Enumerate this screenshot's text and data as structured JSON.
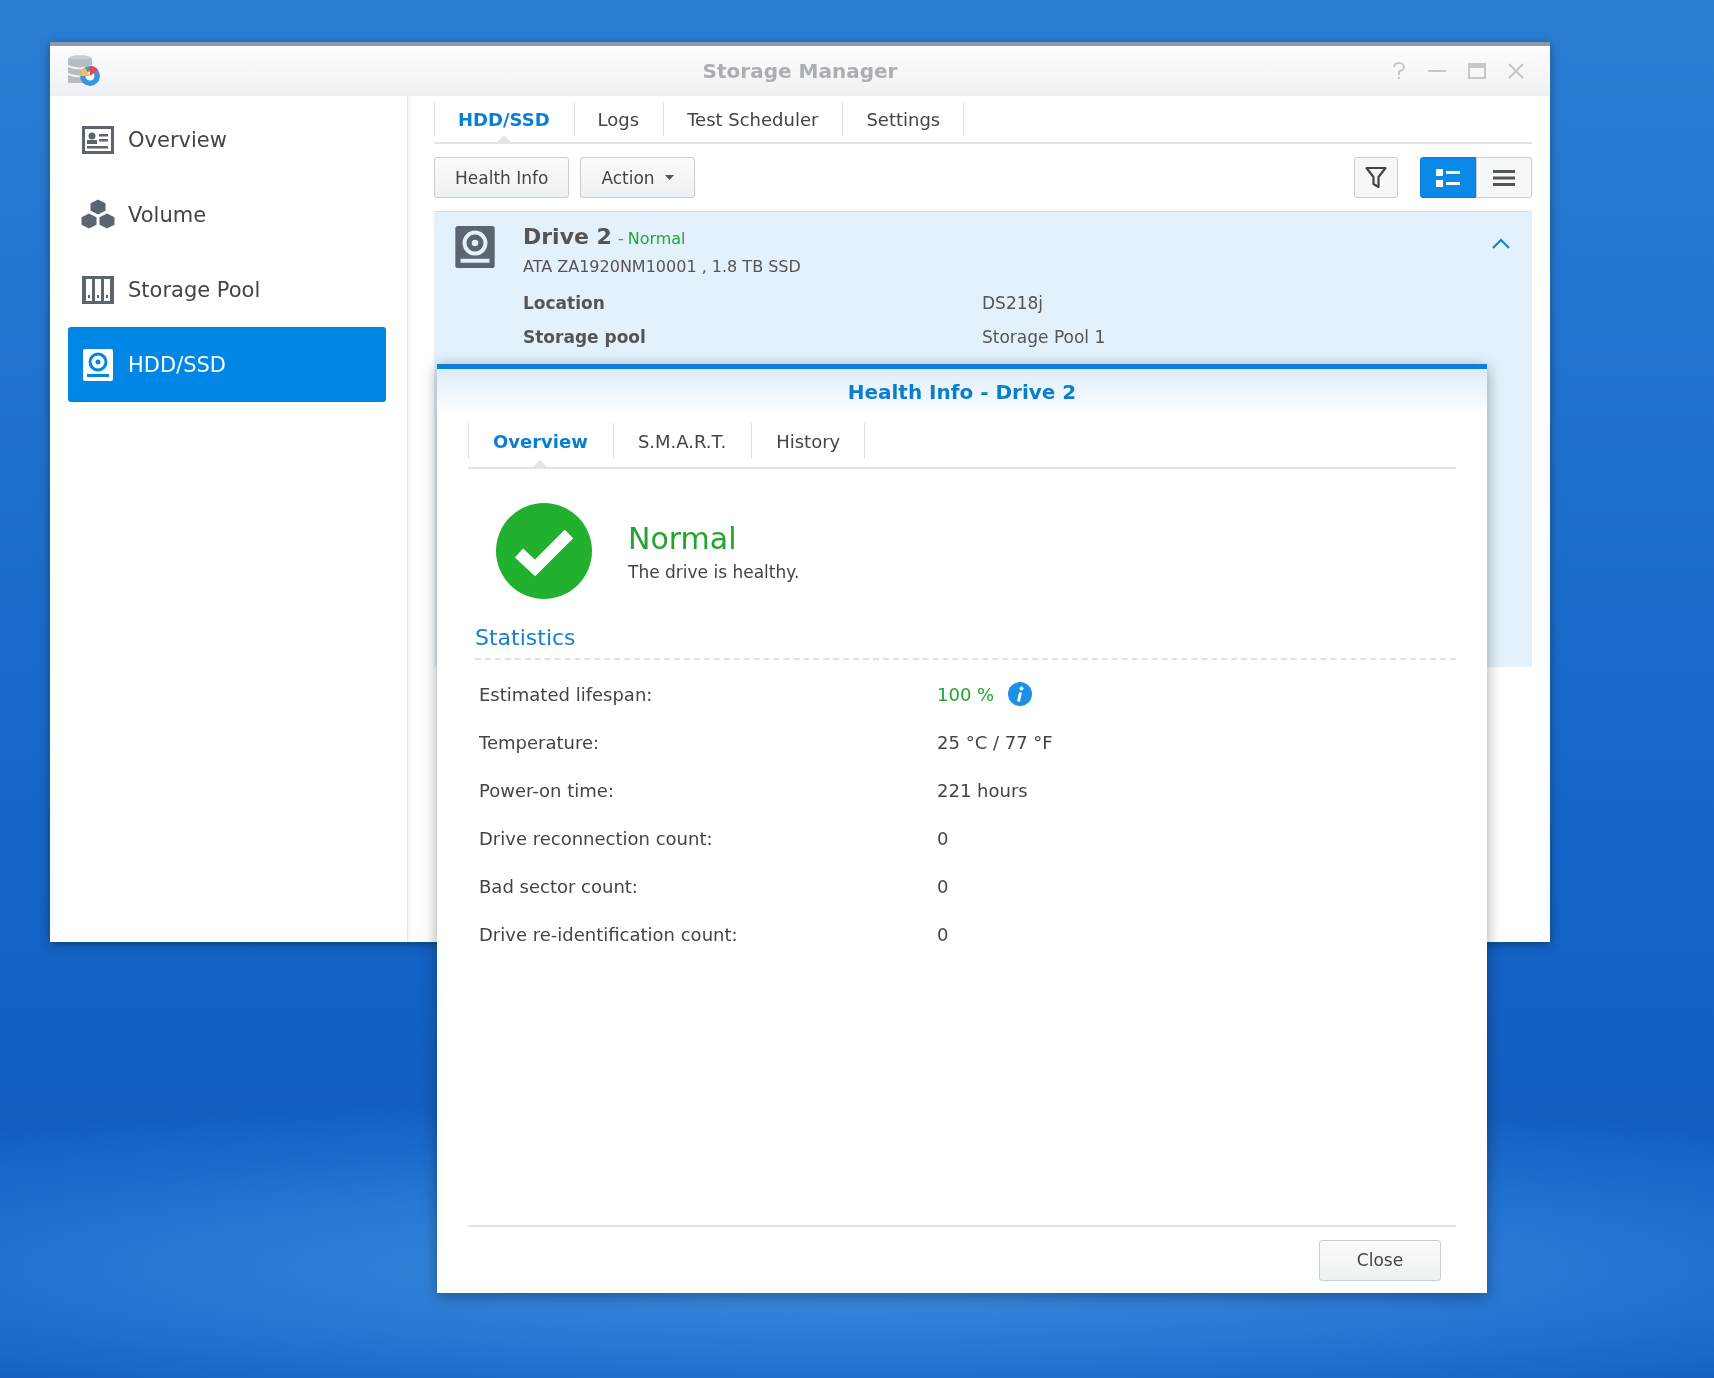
{
  "window": {
    "title": "Storage Manager"
  },
  "sidebar": {
    "items": [
      {
        "label": "Overview",
        "kind": "overview",
        "selected": false
      },
      {
        "label": "Volume",
        "kind": "volume",
        "selected": false
      },
      {
        "label": "Storage Pool",
        "kind": "pool",
        "selected": false
      },
      {
        "label": "HDD/SSD",
        "kind": "drive",
        "selected": true
      }
    ]
  },
  "tabs": [
    {
      "label": "HDD/SSD",
      "selected": true
    },
    {
      "label": "Logs",
      "selected": false
    },
    {
      "label": "Test Scheduler",
      "selected": false
    },
    {
      "label": "Settings",
      "selected": false
    }
  ],
  "toolbar": {
    "buttons": [
      {
        "label": "Health Info",
        "kind": "plain"
      },
      {
        "label": "Action",
        "kind": "menu"
      }
    ],
    "views": [
      {
        "kind": "detail",
        "selected": true
      },
      {
        "kind": "compact",
        "selected": false
      }
    ]
  },
  "drive": {
    "name": "Drive 2",
    "status_separator": "-",
    "status": "Normal",
    "model": "ATA ZA1920NM10001 , 1.8 TB SSD",
    "expanded": true,
    "details": [
      {
        "label": "Location",
        "value": "DS218j"
      },
      {
        "label": "Storage pool",
        "value": "Storage Pool 1"
      }
    ]
  },
  "dialog": {
    "title": "Health Info - Drive 2",
    "tabs": [
      {
        "label": "Overview",
        "selected": true
      },
      {
        "label": "S.M.A.R.T.",
        "selected": false
      },
      {
        "label": "History",
        "selected": false
      }
    ],
    "health": {
      "status": "Normal",
      "message": "The drive is healthy."
    },
    "section": "Statistics",
    "stats": [
      {
        "label": "Estimated lifespan:",
        "value": "100 %",
        "kind": "good",
        "info": true
      },
      {
        "label": "Temperature:",
        "value": "25 °C / 77 °F",
        "kind": "plain",
        "info": false
      },
      {
        "label": "Power-on time:",
        "value": "221 hours",
        "kind": "plain",
        "info": false
      },
      {
        "label": "Drive reconnection count:",
        "value": "0",
        "kind": "plain",
        "info": false
      },
      {
        "label": "Bad sector count:",
        "value": "0",
        "kind": "plain",
        "info": false
      },
      {
        "label": "Drive re-identification count:",
        "value": "0",
        "kind": "plain",
        "info": false
      }
    ],
    "close": "Close"
  }
}
